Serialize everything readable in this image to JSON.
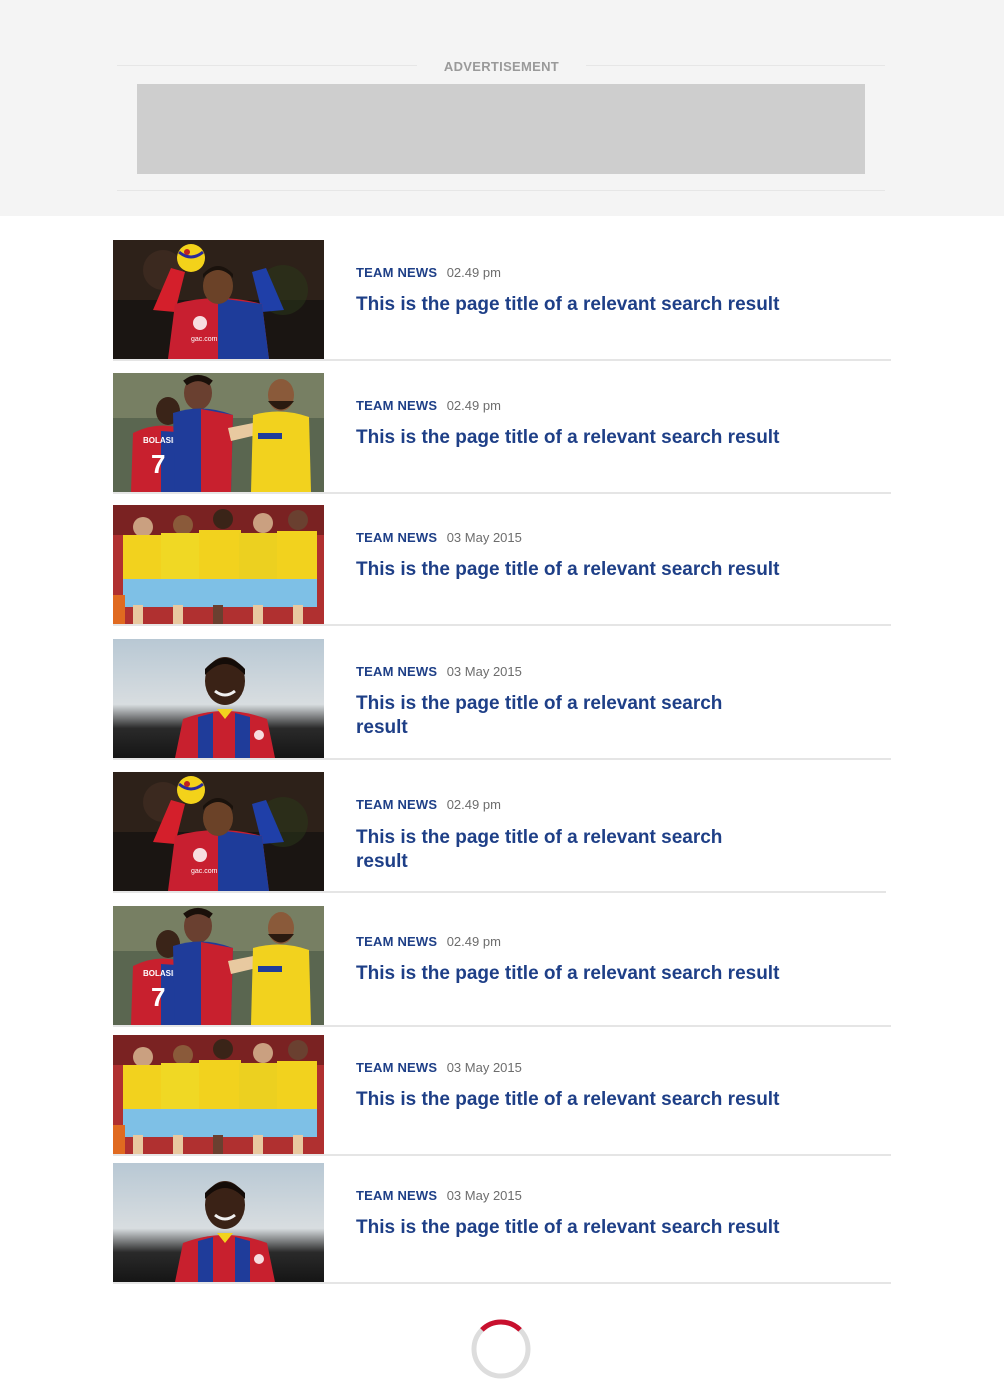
{
  "advertisement": {
    "label": "ADVERTISEMENT"
  },
  "results": [
    {
      "category": "TEAM NEWS",
      "time": "02.49 pm",
      "title": "This is the page title of a relevant search result",
      "image": "player-holding-ball-photo"
    },
    {
      "category": "TEAM NEWS",
      "time": "02.49 pm",
      "title": "This is the page title of a relevant search result",
      "image": "players-celebrating-photo"
    },
    {
      "category": "TEAM NEWS",
      "time": "03 May 2015",
      "title": "This is the page title of a relevant search result",
      "image": "team-huddle-photo"
    },
    {
      "category": "TEAM NEWS",
      "time": "03 May 2015",
      "title": "This is the page title of a relevant search result",
      "image": "player-smiling-photo"
    },
    {
      "category": "TEAM NEWS",
      "time": "02.49 pm",
      "title": "This is the page title of a relevant search result",
      "image": "player-holding-ball-photo"
    },
    {
      "category": "TEAM NEWS",
      "time": "02.49 pm",
      "title": "This is the page title of a relevant search result",
      "image": "players-celebrating-photo"
    },
    {
      "category": "TEAM NEWS",
      "time": "03 May 2015",
      "title": "This is the page title of a relevant search result",
      "image": "team-huddle-photo"
    },
    {
      "category": "TEAM NEWS",
      "time": "03 May 2015",
      "title": "This is the page title of a relevant search result",
      "image": "player-smiling-photo"
    }
  ],
  "thumbnail_text": {
    "shirt_sponsor": "gac.com",
    "player_name": "BOLASIE",
    "player_number": "7"
  },
  "colors": {
    "link_blue": "#1e3f87",
    "spinner_red": "#c8102e",
    "spinner_gray": "#dddddd"
  },
  "loading_spinner": {
    "icon": "loading-spinner-icon",
    "progress": 0.25
  }
}
